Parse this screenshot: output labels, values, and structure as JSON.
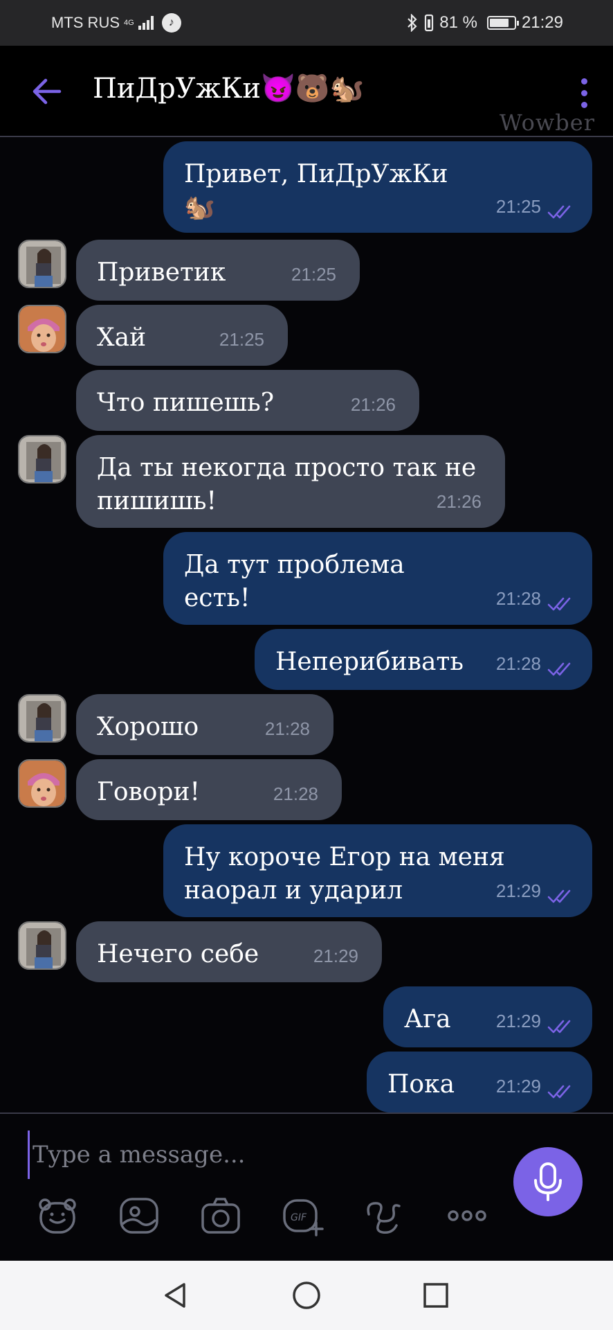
{
  "status_bar": {
    "carrier": "MTS RUS",
    "network": "4G",
    "battery": "81 %",
    "battery_level": 0.81,
    "time": "21:29",
    "icons": [
      "signal-icon",
      "tiktok-icon",
      "bluetooth-icon",
      "vibrate-icon",
      "battery-icon"
    ]
  },
  "header": {
    "title": "ПиДрУжКи😈🐻🐿️",
    "watermark": "Wowber",
    "icons": [
      "back-arrow-icon",
      "more-vert-icon"
    ]
  },
  "messages": [
    {
      "dir": "out",
      "text": "Привет, ПиДрУжКи\n🐿️",
      "time": "21:25",
      "ticks": true
    },
    {
      "dir": "in",
      "text": "Приветик",
      "time": "21:25",
      "avatar": "a"
    },
    {
      "dir": "in",
      "text": "Хай",
      "time": "21:25",
      "avatar": "b"
    },
    {
      "dir": "in",
      "text": "Что пишешь?",
      "time": "21:26"
    },
    {
      "dir": "in",
      "text": "Да ты некогда просто так не\nпишишь!",
      "time": "21:26",
      "avatar": "a"
    },
    {
      "dir": "out",
      "text": "Да тут проблема\nесть!",
      "time": "21:28",
      "ticks": true
    },
    {
      "dir": "out",
      "text": "Неперибивать",
      "time": "21:28",
      "ticks": true
    },
    {
      "dir": "in",
      "text": "Хорошо",
      "time": "21:28",
      "avatar": "a"
    },
    {
      "dir": "in",
      "text": "Говори!",
      "time": "21:28",
      "avatar": "b"
    },
    {
      "dir": "out",
      "text": "Ну короче Егор на меня\nнаорал и ударил",
      "time": "21:29",
      "ticks": true
    },
    {
      "dir": "in",
      "text": "Нечего себе",
      "time": "21:29",
      "avatar": "a"
    },
    {
      "dir": "out",
      "text": "Ага",
      "time": "21:29",
      "ticks": true
    },
    {
      "dir": "out",
      "text": "Пока",
      "time": "21:29",
      "ticks": true
    }
  ],
  "composer": {
    "placeholder": "Type a message...",
    "tools": [
      "sticker-bear-icon",
      "gallery-icon",
      "camera-icon",
      "gif-icon",
      "doodle-icon",
      "more-horizontal-icon"
    ],
    "mic": "microphone-icon"
  },
  "nav": [
    "nav-back-icon",
    "nav-home-icon",
    "nav-recents-icon"
  ],
  "colors": {
    "accent": "#7b63e6",
    "incoming_bubble": "#3f4554",
    "outgoing_bubble": "#163461",
    "background": "#050508"
  }
}
